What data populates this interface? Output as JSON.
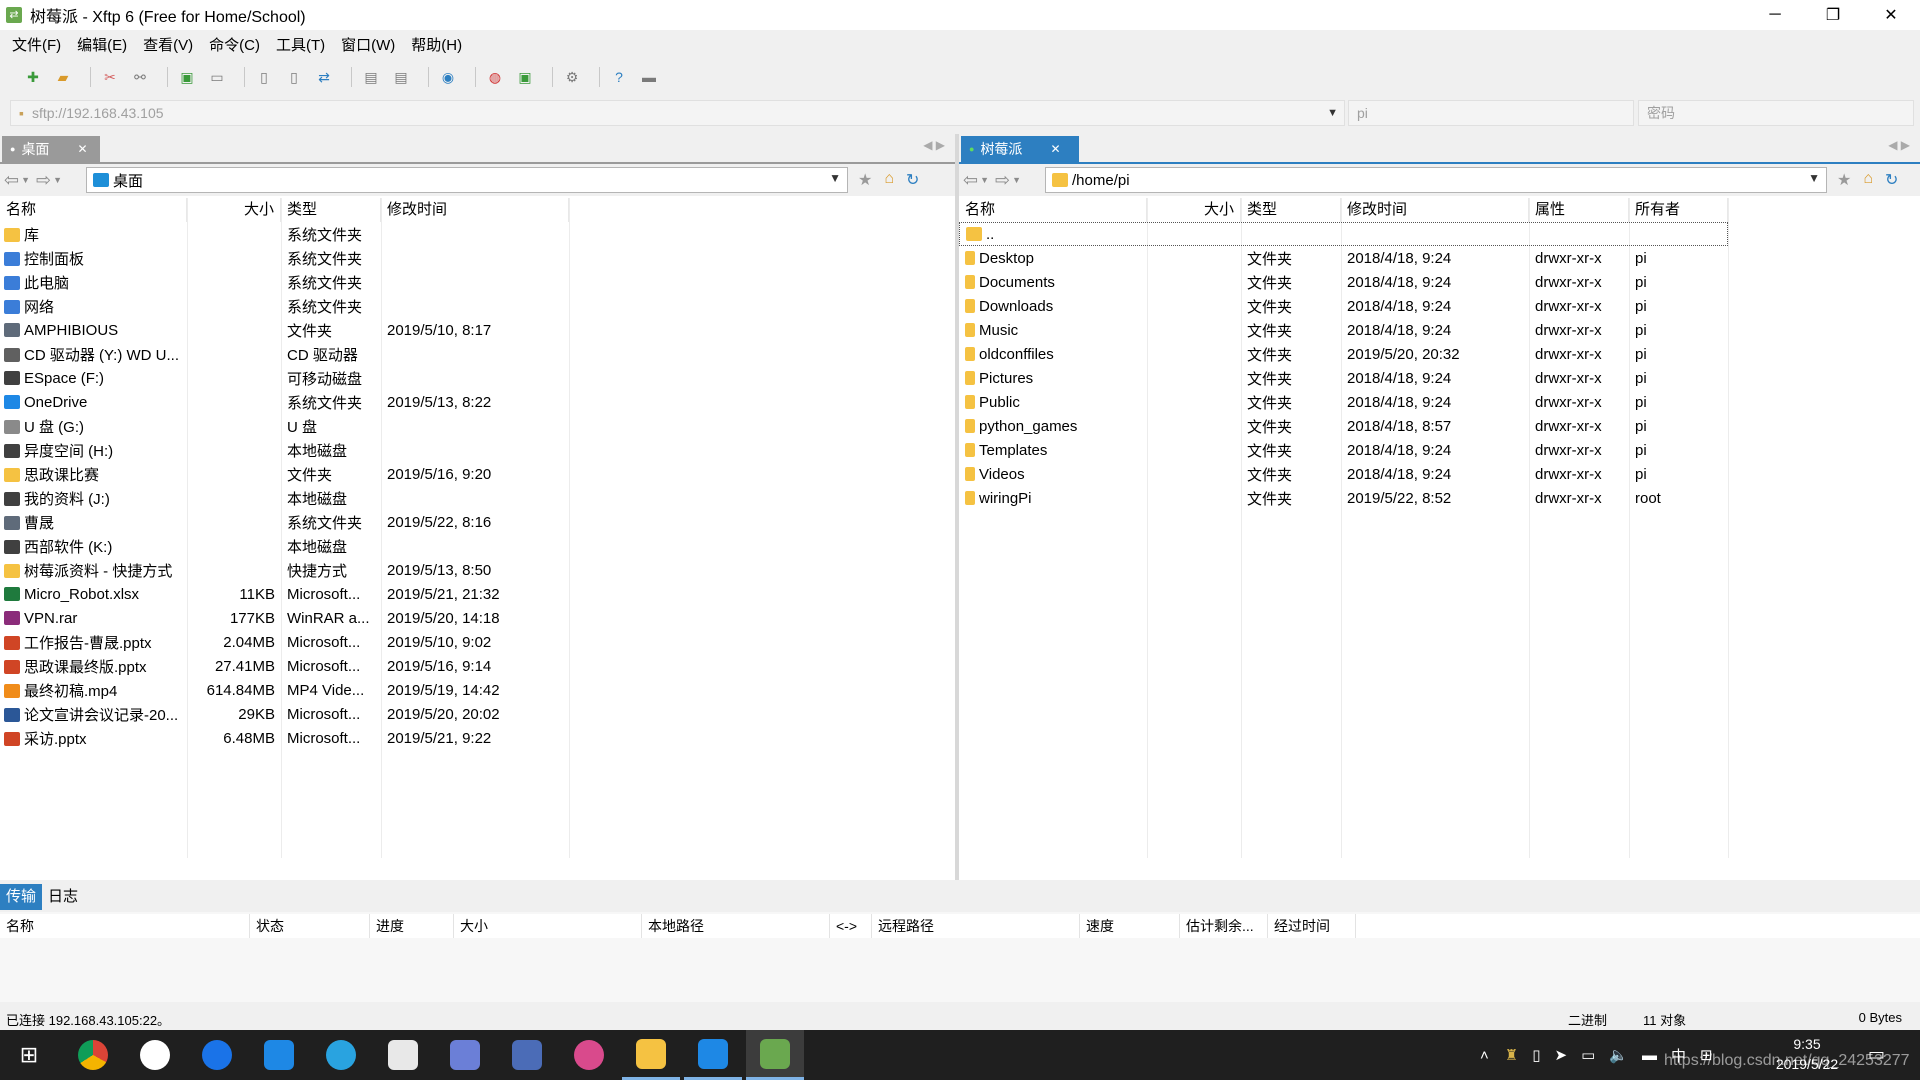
{
  "window": {
    "title": "树莓派 - Xftp 6 (Free for Home/School)"
  },
  "menu": [
    "文件(F)",
    "编辑(E)",
    "查看(V)",
    "命令(C)",
    "工具(T)",
    "窗口(W)",
    "帮助(H)"
  ],
  "address": {
    "url": "sftp://192.168.43.105",
    "user": "pi",
    "password_placeholder": "密码"
  },
  "local": {
    "tab_label": "桌面",
    "path": "桌面",
    "columns": [
      "名称",
      "大小",
      "类型",
      "修改时间"
    ],
    "rows": [
      {
        "name": "库",
        "size": "",
        "type": "系统文件夹",
        "modified": "",
        "icon": "library-icon"
      },
      {
        "name": "控制面板",
        "size": "",
        "type": "系统文件夹",
        "modified": "",
        "icon": "control-panel-icon"
      },
      {
        "name": "此电脑",
        "size": "",
        "type": "系统文件夹",
        "modified": "",
        "icon": "computer-icon"
      },
      {
        "name": "网络",
        "size": "",
        "type": "系统文件夹",
        "modified": "",
        "icon": "network-icon"
      },
      {
        "name": "AMPHIBIOUS",
        "size": "",
        "type": "文件夹",
        "modified": "2019/5/10, 8:17",
        "icon": "user-folder-icon"
      },
      {
        "name": "CD 驱动器 (Y:) WD U...",
        "size": "",
        "type": "CD 驱动器",
        "modified": "",
        "icon": "cd-drive-icon"
      },
      {
        "name": "ESpace (F:)",
        "size": "",
        "type": "可移动磁盘",
        "modified": "",
        "icon": "drive-icon"
      },
      {
        "name": "OneDrive",
        "size": "",
        "type": "系统文件夹",
        "modified": "2019/5/13, 8:22",
        "icon": "cloud-icon"
      },
      {
        "name": "U 盘 (G:)",
        "size": "",
        "type": "U 盘",
        "modified": "",
        "icon": "usb-drive-icon"
      },
      {
        "name": "异度空间 (H:)",
        "size": "",
        "type": "本地磁盘",
        "modified": "",
        "icon": "drive-icon"
      },
      {
        "name": "思政课比赛",
        "size": "",
        "type": "文件夹",
        "modified": "2019/5/16, 9:20",
        "icon": "folder-icon"
      },
      {
        "name": "我的资料 (J:)",
        "size": "",
        "type": "本地磁盘",
        "modified": "",
        "icon": "drive-icon"
      },
      {
        "name": "曹晟",
        "size": "",
        "type": "系统文件夹",
        "modified": "2019/5/22, 8:16",
        "icon": "user-folder-icon"
      },
      {
        "name": "西部软件 (K:)",
        "size": "",
        "type": "本地磁盘",
        "modified": "",
        "icon": "drive-icon"
      },
      {
        "name": "树莓派资料 - 快捷方式",
        "size": "",
        "type": "快捷方式",
        "modified": "2019/5/13, 8:50",
        "icon": "shortcut-icon"
      },
      {
        "name": "Micro_Robot.xlsx",
        "size": "11KB",
        "type": "Microsoft...",
        "modified": "2019/5/21, 21:32",
        "icon": "excel-icon"
      },
      {
        "name": "VPN.rar",
        "size": "177KB",
        "type": "WinRAR a...",
        "modified": "2019/5/20, 14:18",
        "icon": "rar-icon"
      },
      {
        "name": "工作报告-曹晟.pptx",
        "size": "2.04MB",
        "type": "Microsoft...",
        "modified": "2019/5/10, 9:02",
        "icon": "ppt-icon"
      },
      {
        "name": "思政课最终版.pptx",
        "size": "27.41MB",
        "type": "Microsoft...",
        "modified": "2019/5/16, 9:14",
        "icon": "ppt-icon"
      },
      {
        "name": "最终初稿.mp4",
        "size": "614.84MB",
        "type": "MP4 Vide...",
        "modified": "2019/5/19, 14:42",
        "icon": "vlc-icon"
      },
      {
        "name": "论文宣讲会议记录-20...",
        "size": "29KB",
        "type": "Microsoft...",
        "modified": "2019/5/20, 20:02",
        "icon": "word-icon"
      },
      {
        "name": "采访.pptx",
        "size": "6.48MB",
        "type": "Microsoft...",
        "modified": "2019/5/21, 9:22",
        "icon": "ppt-icon"
      }
    ]
  },
  "remote": {
    "tab_label": "树莓派",
    "path": "/home/pi",
    "columns": [
      "名称",
      "大小",
      "类型",
      "修改时间",
      "属性",
      "所有者"
    ],
    "parent_row": "..",
    "rows": [
      {
        "name": "Desktop",
        "size": "",
        "type": "文件夹",
        "modified": "2018/4/18, 9:24",
        "perm": "drwxr-xr-x",
        "owner": "pi"
      },
      {
        "name": "Documents",
        "size": "",
        "type": "文件夹",
        "modified": "2018/4/18, 9:24",
        "perm": "drwxr-xr-x",
        "owner": "pi"
      },
      {
        "name": "Downloads",
        "size": "",
        "type": "文件夹",
        "modified": "2018/4/18, 9:24",
        "perm": "drwxr-xr-x",
        "owner": "pi"
      },
      {
        "name": "Music",
        "size": "",
        "type": "文件夹",
        "modified": "2018/4/18, 9:24",
        "perm": "drwxr-xr-x",
        "owner": "pi"
      },
      {
        "name": "oldconffiles",
        "size": "",
        "type": "文件夹",
        "modified": "2019/5/20, 20:32",
        "perm": "drwxr-xr-x",
        "owner": "pi"
      },
      {
        "name": "Pictures",
        "size": "",
        "type": "文件夹",
        "modified": "2018/4/18, 9:24",
        "perm": "drwxr-xr-x",
        "owner": "pi"
      },
      {
        "name": "Public",
        "size": "",
        "type": "文件夹",
        "modified": "2018/4/18, 9:24",
        "perm": "drwxr-xr-x",
        "owner": "pi"
      },
      {
        "name": "python_games",
        "size": "",
        "type": "文件夹",
        "modified": "2018/4/18, 8:57",
        "perm": "drwxr-xr-x",
        "owner": "pi"
      },
      {
        "name": "Templates",
        "size": "",
        "type": "文件夹",
        "modified": "2018/4/18, 9:24",
        "perm": "drwxr-xr-x",
        "owner": "pi"
      },
      {
        "name": "Videos",
        "size": "",
        "type": "文件夹",
        "modified": "2018/4/18, 9:24",
        "perm": "drwxr-xr-x",
        "owner": "pi"
      },
      {
        "name": "wiringPi",
        "size": "",
        "type": "文件夹",
        "modified": "2019/5/22, 8:52",
        "perm": "drwxr-xr-x",
        "owner": "root"
      }
    ]
  },
  "bottom": {
    "tabs": [
      "传输",
      "日志"
    ],
    "columns": [
      "名称",
      "状态",
      "进度",
      "大小",
      "本地路径",
      "<->",
      "远程路径",
      "速度",
      "估计剩余...",
      "经过时间"
    ]
  },
  "status": {
    "left": "已连接 192.168.43.105:22。",
    "mode": "二进制",
    "objects": "11 对象",
    "bytes": "0 Bytes"
  },
  "taskbar": {
    "time": "9:35",
    "date": "2019/5/22",
    "ime": "中",
    "watermark": "https://blog.csdn.net/qq_24253277"
  },
  "colors": {
    "accent": "#2d7fc1",
    "folder": "#f5c242",
    "taskbar": "#1f1f1f"
  }
}
